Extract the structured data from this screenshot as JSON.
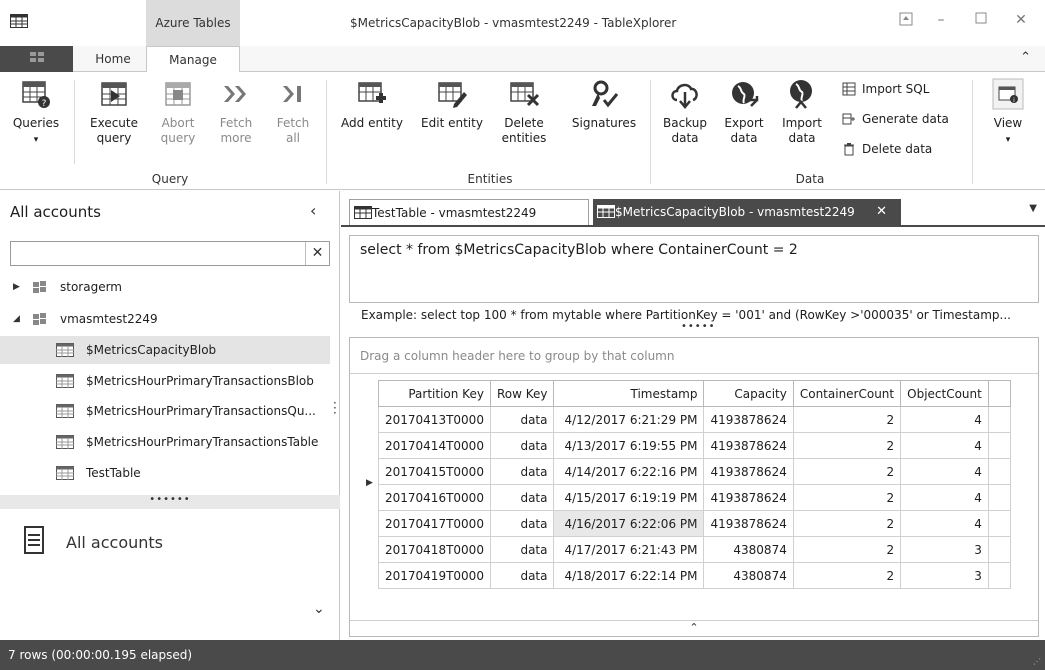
{
  "window": {
    "contextual_tab": "Azure Tables",
    "title": "$MetricsCapacityBlob - vmasmtest2249 - TableXplorer"
  },
  "ribbon_tabs": {
    "home": "Home",
    "manage": "Manage"
  },
  "ribbon": {
    "queries": "Queries",
    "execute_query_1": "Execute",
    "execute_query_2": "query",
    "abort_query_1": "Abort",
    "abort_query_2": "query",
    "fetch_more_1": "Fetch",
    "fetch_more_2": "more",
    "fetch_all_1": "Fetch",
    "fetch_all_2": "all",
    "group_query": "Query",
    "add_entity": "Add entity",
    "edit_entity": "Edit entity",
    "delete_entities_1": "Delete",
    "delete_entities_2": "entities",
    "signatures": "Signatures",
    "group_entities": "Entities",
    "backup_data_1": "Backup",
    "backup_data_2": "data",
    "export_data_1": "Export",
    "export_data_2": "data",
    "import_data_1": "Import",
    "import_data_2": "data",
    "import_sql": "Import SQL",
    "generate_data": "Generate data",
    "delete_data": "Delete data",
    "group_data": "Data",
    "view": "View"
  },
  "left_panel": {
    "header": "All accounts",
    "search_value": "",
    "tree": [
      {
        "label": "storagerm"
      },
      {
        "label": "vmasmtest2249"
      },
      {
        "label": "$MetricsCapacityBlob"
      },
      {
        "label": "$MetricsHourPrimaryTransactionsBlob"
      },
      {
        "label": "$MetricsHourPrimaryTransactionsQu..."
      },
      {
        "label": "$MetricsHourPrimaryTransactionsTable"
      },
      {
        "label": "TestTable"
      }
    ],
    "bottom_label": "All accounts"
  },
  "doc_tabs": {
    "tab1": "TestTable - vmasmtest2249",
    "tab2": "$MetricsCapacityBlob - vmasmtest2249"
  },
  "query": {
    "text": "select * from $MetricsCapacityBlob where ContainerCount = 2",
    "example": "Example: select top 100 * from mytable where PartitionKey = '001' and (RowKey >'000035' or Timestamp..."
  },
  "grid": {
    "group_hint": "Drag a column header here to group by that column",
    "columns": [
      "Partition Key",
      "Row Key",
      "Timestamp",
      "Capacity",
      "ContainerCount",
      "ObjectCount"
    ],
    "rows": [
      [
        "20170413T0000",
        "data",
        "4/12/2017 6:21:29 PM",
        "4193878624",
        "2",
        "4"
      ],
      [
        "20170414T0000",
        "data",
        "4/13/2017 6:19:55 PM",
        "4193878624",
        "2",
        "4"
      ],
      [
        "20170415T0000",
        "data",
        "4/14/2017 6:22:16 PM",
        "4193878624",
        "2",
        "4"
      ],
      [
        "20170416T0000",
        "data",
        "4/15/2017 6:19:19 PM",
        "4193878624",
        "2",
        "4"
      ],
      [
        "20170417T0000",
        "data",
        "4/16/2017 6:22:06 PM",
        "4193878624",
        "2",
        "4"
      ],
      [
        "20170418T0000",
        "data",
        "4/17/2017 6:21:43 PM",
        "4380874",
        "2",
        "3"
      ],
      [
        "20170419T0000",
        "data",
        "4/18/2017 6:22:14 PM",
        "4380874",
        "2",
        "3"
      ]
    ]
  },
  "status": {
    "text": "7 rows (00:00:00.195 elapsed)"
  },
  "colors": {
    "dark": "#4a4a4a",
    "contextual_tab_bg": "#dcdcdc",
    "selection": "#e4e4e4"
  }
}
